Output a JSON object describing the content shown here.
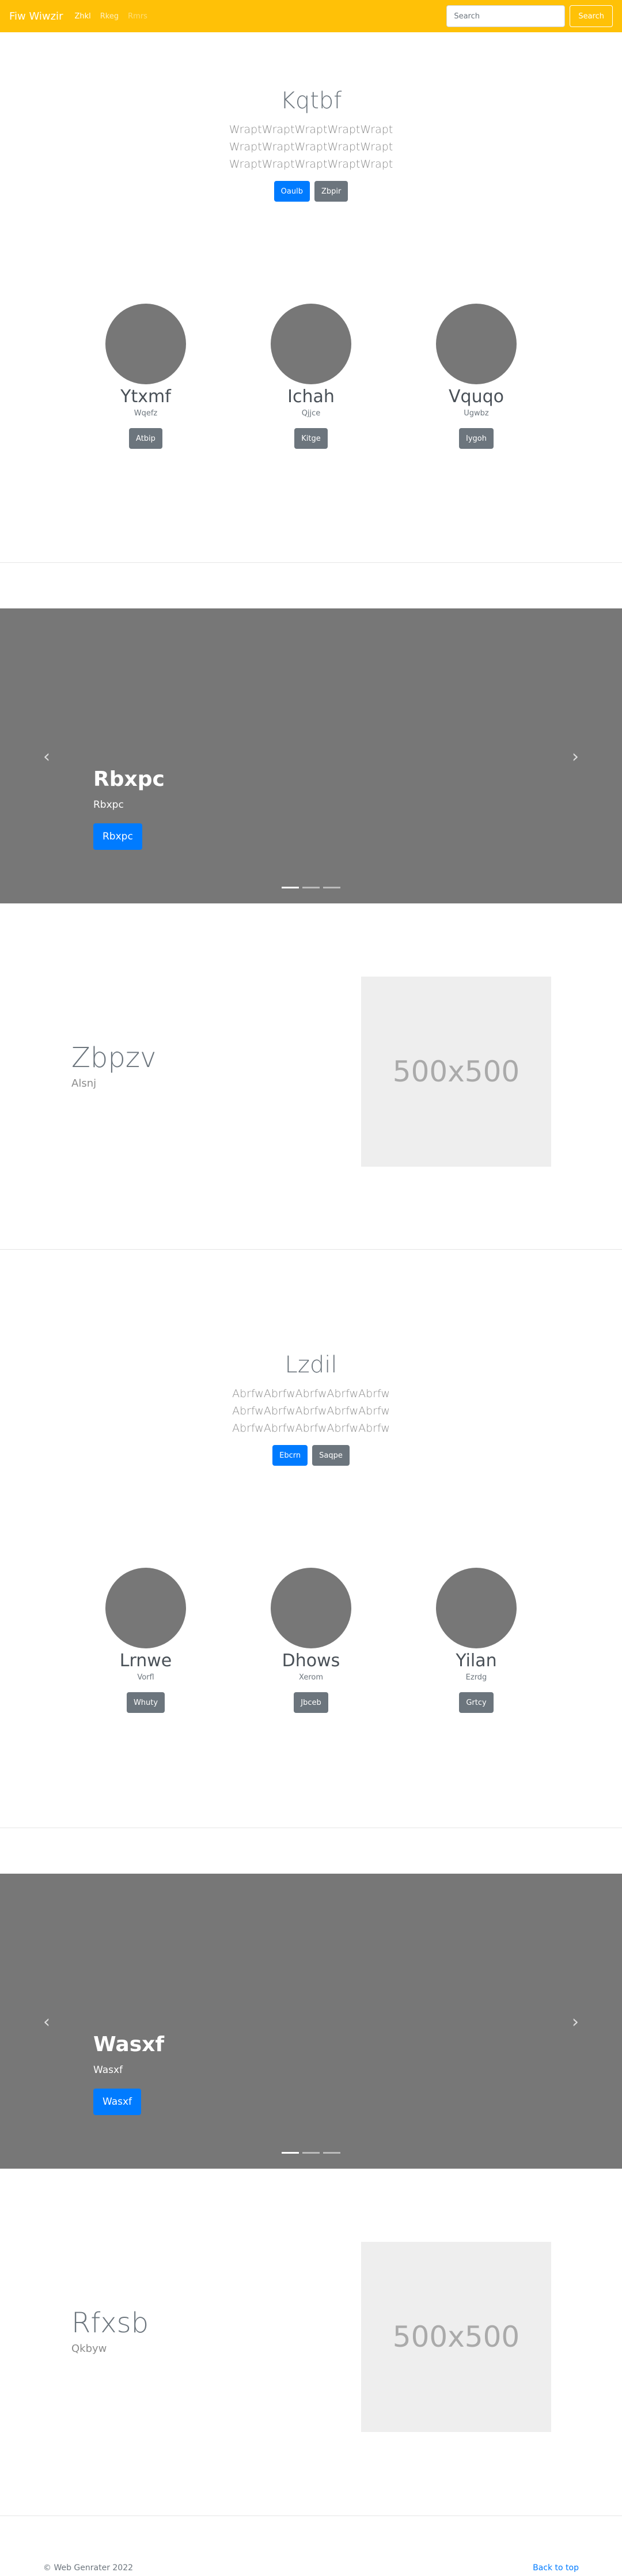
{
  "navbar": {
    "brand": "Fiw Wiwzir",
    "links": [
      "Zhkl",
      "Rkeg",
      "Rmrs"
    ],
    "search_placeholder": "Search",
    "search_button": "Search"
  },
  "section1": {
    "title": "Kqtbf",
    "lead_lines": [
      "WraptWraptWraptWraptWrapt",
      "WraptWraptWraptWraptWrapt",
      "WraptWraptWraptWraptWrapt"
    ],
    "primary_button": "Oaulb",
    "secondary_button": "Zbpir",
    "profiles": [
      {
        "name": "Ytxmf",
        "sub": "Wqefz",
        "button": "Atbip"
      },
      {
        "name": "Ichah",
        "sub": "Qjjce",
        "button": "Kitge"
      },
      {
        "name": "Vquqo",
        "sub": "Ugwbz",
        "button": "Iygoh"
      }
    ]
  },
  "carousel1": {
    "title": "Rbxpc",
    "text": "Rbxpc",
    "button": "Rbxpc",
    "prev_icon": "‹",
    "next_icon": "›"
  },
  "feature1": {
    "title": "Zbpzv",
    "subtitle": "Alsnj",
    "image_label": "500x500"
  },
  "section2": {
    "title": "Lzdil",
    "lead_lines": [
      "AbrfwAbrfwAbrfwAbrfwAbrfw",
      "AbrfwAbrfwAbrfwAbrfwAbrfw",
      "AbrfwAbrfwAbrfwAbrfwAbrfw"
    ],
    "primary_button": "Ebcrn",
    "secondary_button": "Saqpe",
    "profiles": [
      {
        "name": "Lrnwe",
        "sub": "Vorfl",
        "button": "Whuty"
      },
      {
        "name": "Dhows",
        "sub": "Xerom",
        "button": "Jbceb"
      },
      {
        "name": "Yilan",
        "sub": "Ezrdg",
        "button": "Grtcy"
      }
    ]
  },
  "carousel2": {
    "title": "Wasxf",
    "text": "Wasxf",
    "button": "Wasxf",
    "prev_icon": "‹",
    "next_icon": "›"
  },
  "feature2": {
    "title": "Rfxsb",
    "subtitle": "Qkbyw",
    "image_label": "500x500"
  },
  "footer": {
    "copyright": "© Web Genrater 2022",
    "back_to_top": "Back to top"
  }
}
